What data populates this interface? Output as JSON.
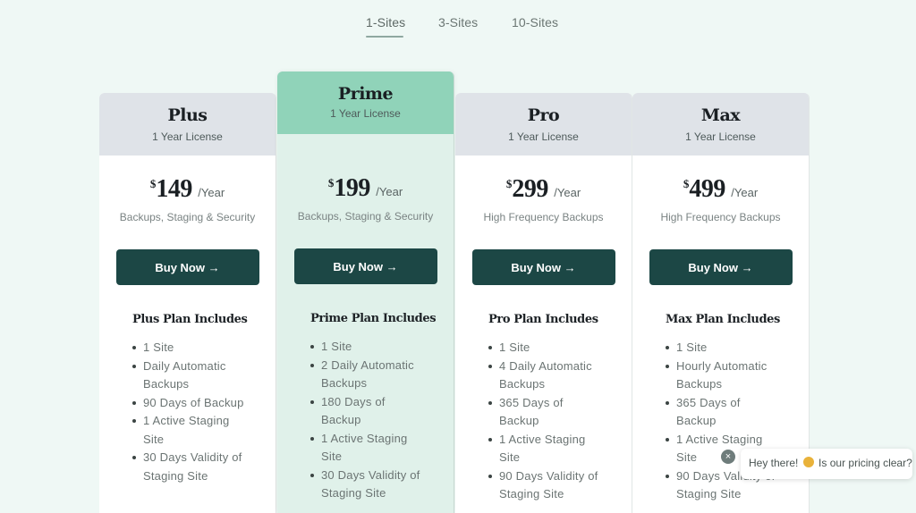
{
  "tabs": [
    {
      "label": "1-Sites",
      "active": true
    },
    {
      "label": "3-Sites",
      "active": false
    },
    {
      "label": "10-Sites",
      "active": false
    }
  ],
  "plans": [
    {
      "name": "Plus",
      "license": "1 Year License",
      "currency": "$",
      "price": "149",
      "period": "/Year",
      "description": "Backups, Staging & Security",
      "button_label": "Buy Now →",
      "includes_title": "Plus Plan Includes",
      "features": [
        "1 Site",
        "Daily Automatic Backups",
        "90 Days of Backup",
        "1 Active Staging Site",
        "30 Days Validity of Staging Site"
      ],
      "featured": false
    },
    {
      "name": "Prime",
      "license": "1 Year License",
      "currency": "$",
      "price": "199",
      "period": "/Year",
      "description": "Backups, Staging & Security",
      "button_label": "Buy Now →",
      "includes_title": "Prime Plan Includes",
      "features": [
        "1 Site",
        "2 Daily Automatic Backups",
        "180 Days of Backup",
        "1 Active Staging Site",
        "30 Days Validity of Staging Site"
      ],
      "featured": true
    },
    {
      "name": "Pro",
      "license": "1 Year License",
      "currency": "$",
      "price": "299",
      "period": "/Year",
      "description": "High Frequency Backups",
      "button_label": "Buy Now →",
      "includes_title": "Pro Plan Includes",
      "features": [
        "1 Site",
        "4 Daily Automatic Backups",
        "365 Days of Backup",
        "1 Active Staging Site",
        "90 Days Validity of Staging Site"
      ],
      "featured": false
    },
    {
      "name": "Max",
      "license": "1 Year License",
      "currency": "$",
      "price": "499",
      "period": "/Year",
      "description": "High Frequency Backups",
      "button_label": "Buy Now →",
      "includes_title": "Max Plan Includes",
      "features": [
        "1 Site",
        "Hourly Automatic Backups",
        "365 Days of Backup",
        "1 Active Staging Site",
        "90 Days Validity of Staging Site"
      ],
      "featured": false
    }
  ],
  "chat": {
    "greeting": "Hey there!",
    "emoji": "waving-hand-icon",
    "question": "Is our pricing clear?",
    "close_glyph": "×"
  },
  "colors": {
    "background": "#eff8f5",
    "button": "#1c4745",
    "featured_header": "#90d3b9",
    "featured_body": "#e0f1ea",
    "card_header": "#dfe3e8"
  }
}
